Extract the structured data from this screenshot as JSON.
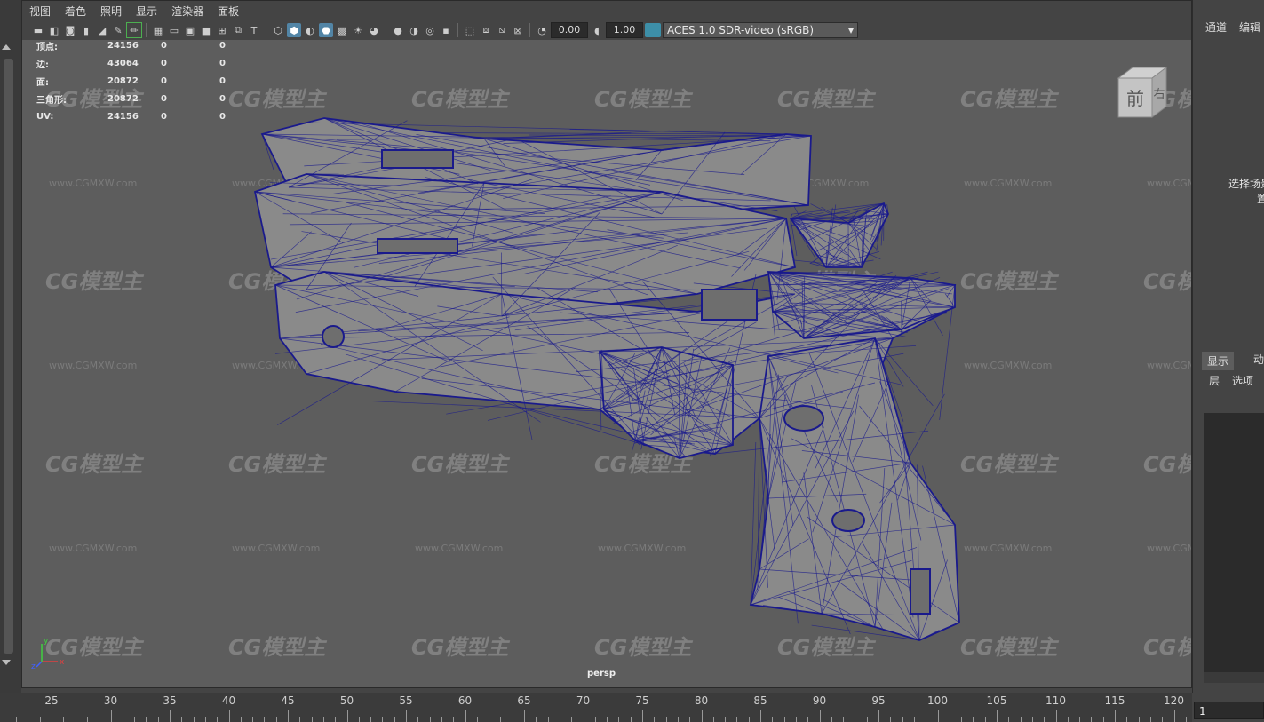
{
  "menu": [
    "视图",
    "着色",
    "照明",
    "显示",
    "渲染器",
    "面板"
  ],
  "toolbar": {
    "exposure_value": "0.00",
    "gamma_value": "1.00",
    "color_management": "ACES 1.0 SDR-video (sRGB)"
  },
  "hud": {
    "rows": [
      {
        "label": "顶点:",
        "v1": "24156",
        "v2": "0",
        "v3": "0"
      },
      {
        "label": "边:",
        "v1": "43064",
        "v2": "0",
        "v3": "0"
      },
      {
        "label": "面:",
        "v1": "20872",
        "v2": "0",
        "v3": "0"
      },
      {
        "label": "三角形:",
        "v1": "20872",
        "v2": "0",
        "v3": "0"
      },
      {
        "label": "UV:",
        "v1": "24156",
        "v2": "0",
        "v3": "0"
      }
    ]
  },
  "viewcube": {
    "face_label": "前",
    "side_label": "右"
  },
  "camera_label": "persp",
  "watermark": {
    "brand": "CG模型主",
    "url": "www.CGMXW.com"
  },
  "right_panel": {
    "tabs": [
      "通道",
      "编辑"
    ],
    "select_hint": "选择场景",
    "select_hint_line2": "置",
    "layer_tabs": [
      "显示",
      "动"
    ],
    "layer_options": [
      "层",
      "选项"
    ]
  },
  "timeline": {
    "ticks": [
      "25",
      "30",
      "35",
      "40",
      "45",
      "50",
      "55",
      "60",
      "65",
      "70",
      "75",
      "80",
      "85",
      "90",
      "95",
      "100",
      "105",
      "110",
      "115",
      "120"
    ]
  },
  "current_frame": "1",
  "colors": {
    "wire": "#1a1a8c",
    "mesh": "#8a8a8a",
    "viewport_bg": "#5d5d5d",
    "accent": "#5285a6"
  }
}
